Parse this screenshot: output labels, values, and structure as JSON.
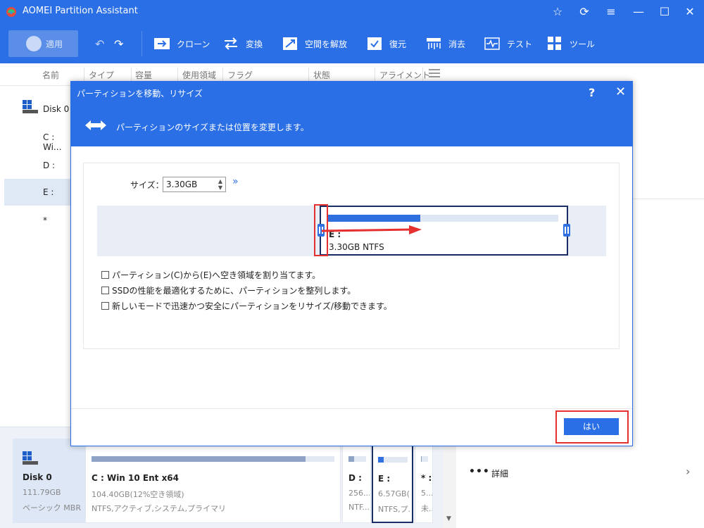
{
  "app": {
    "title": "AOMEI Partition Assistant"
  },
  "toolbar": {
    "apply_label": "適用",
    "items": [
      {
        "label": "クローン",
        "icon": "clone-icon"
      },
      {
        "label": "変換",
        "icon": "convert-icon"
      },
      {
        "label": "空間を解放",
        "icon": "free-space-icon"
      },
      {
        "label": "復元",
        "icon": "recover-icon"
      },
      {
        "label": "消去",
        "icon": "wipe-icon"
      },
      {
        "label": "テスト",
        "icon": "test-icon"
      },
      {
        "label": "ツール",
        "icon": "tools-icon"
      }
    ]
  },
  "columns": [
    "名前",
    "タイプ",
    "容量",
    "使用領域",
    "フラグ",
    "状態",
    "アライメント"
  ],
  "left_list": [
    "Disk 0",
    "C : Wi...",
    "D :",
    "E :",
    "*"
  ],
  "dialog": {
    "title": "パーティションを移動、リサイズ",
    "subtitle": "パーティションのサイズまたは位置を変更します。",
    "help": "?",
    "size_label": "サイズ：",
    "size_value": "3.30GB",
    "partition_label": "E :",
    "partition_info": "3.30GB NTFS",
    "partition_used_fraction": 0.4,
    "checkboxes": [
      "パーティション(C)から(E)へ空き領域を割り当てます。",
      "SSDの性能を最適化するために、パーティションを整列します。",
      "新しいモードで迅速かつ安全にパーティションをリサイズ/移動できます。"
    ],
    "yes_label": "はい"
  },
  "disk": {
    "name": "Disk 0",
    "size": "111.79GB",
    "type": "ベーシック MBR"
  },
  "partitions": [
    {
      "name": "C : Win 10 Ent x64",
      "size": "104.40GB(12%空き領域)",
      "fs": "NTFS,アクティブ,システム,プライマリ",
      "used": 0.88
    },
    {
      "name": "D :",
      "size": "256...",
      "fs": "NTF...",
      "used": 0.3
    },
    {
      "name": "E :",
      "size": "6.57GB(...",
      "fs": "NTFS,プ...",
      "used": 0.2
    },
    {
      "name": "* :",
      "size": "5...",
      "fs": "未...",
      "used": 0.1
    }
  ],
  "details_label": "詳細",
  "colors": {
    "accent": "#2a6fe6",
    "highlight": "#e53030"
  }
}
